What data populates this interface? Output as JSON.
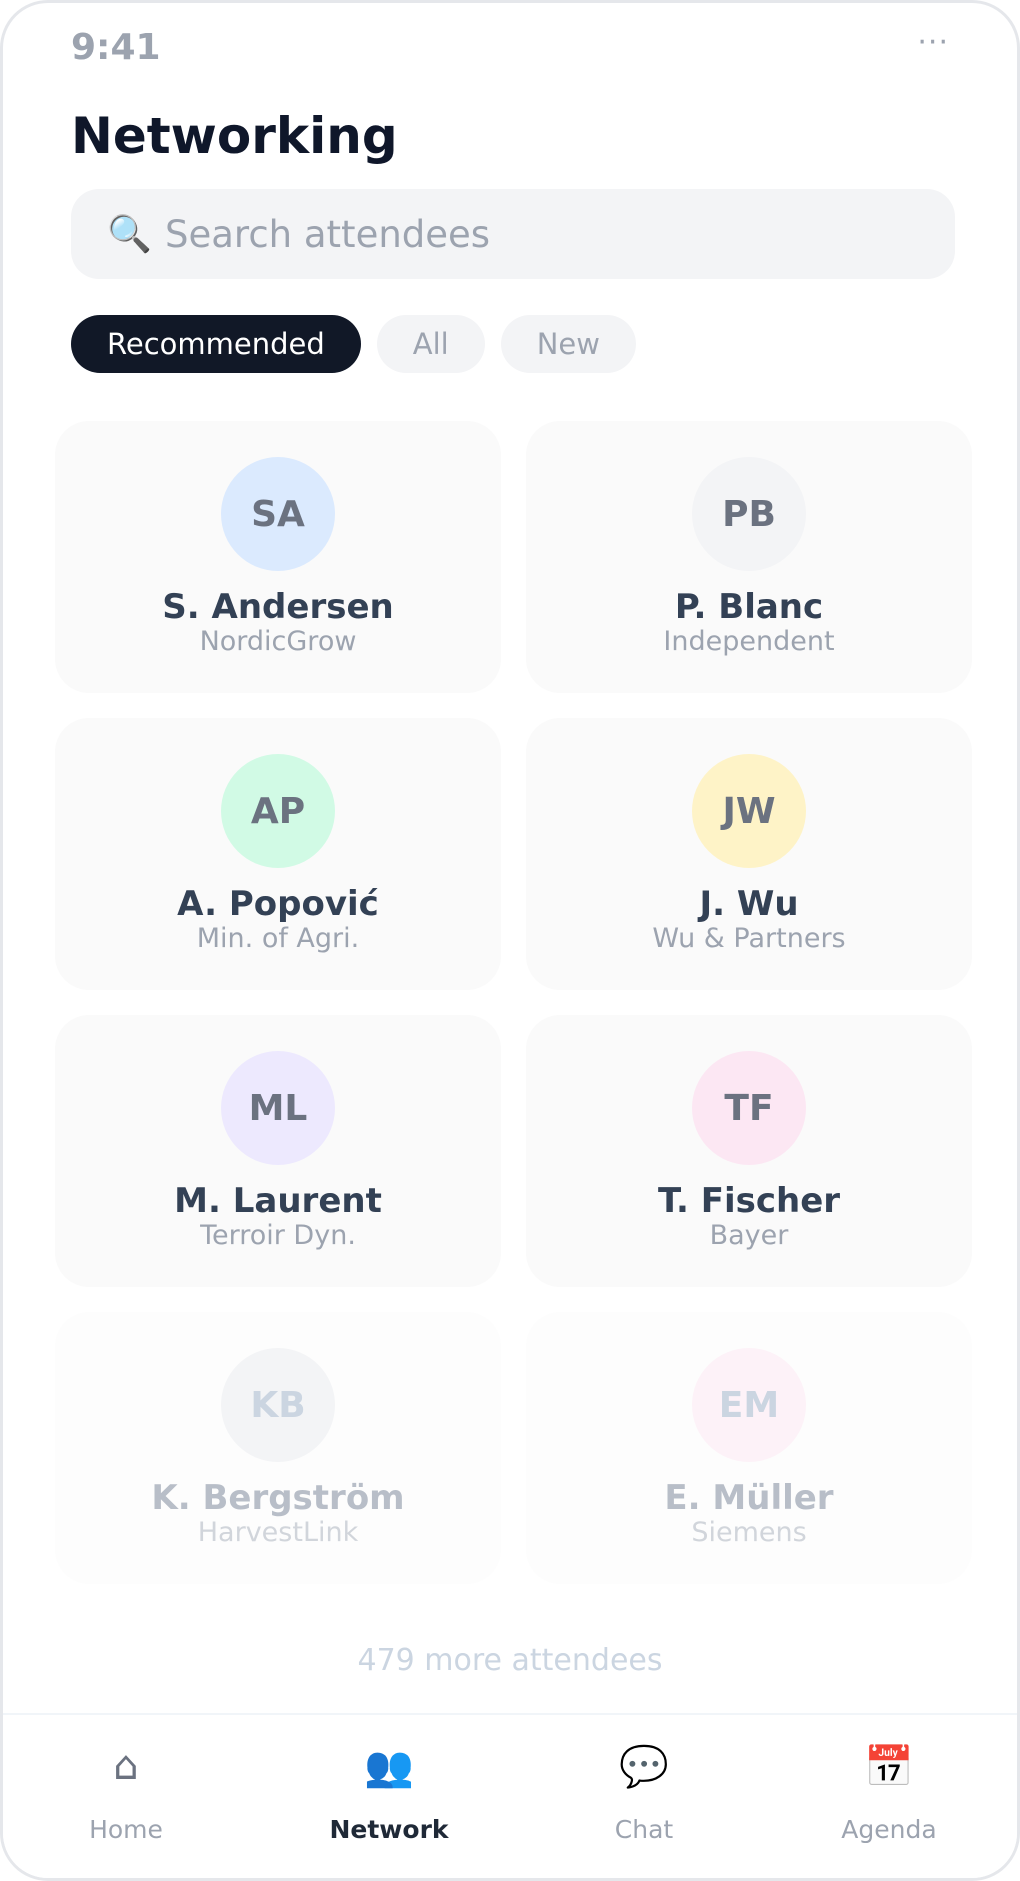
{
  "status_bar": {
    "time": "9:41",
    "more": "···"
  },
  "page": {
    "title": "Networking"
  },
  "search": {
    "icon": "search-icon",
    "placeholder": "Search attendees",
    "value": ""
  },
  "filters": [
    {
      "label": "Recommended",
      "active": true
    },
    {
      "label": "All",
      "active": false
    },
    {
      "label": "New",
      "active": false
    }
  ],
  "attendees": [
    {
      "initials": "SA",
      "name": "S. Andersen",
      "org": "NordicGrow",
      "avatar_color": "#dbeafe"
    },
    {
      "initials": "PB",
      "name": "P. Blanc",
      "org": "Independent",
      "avatar_color": "#f3f4f6"
    },
    {
      "initials": "AP",
      "name": "A. Popović",
      "org": "Min. of Agri.",
      "avatar_color": "#d1fae5"
    },
    {
      "initials": "JW",
      "name": "J. Wu",
      "org": "Wu & Partners",
      "avatar_color": "#fef3c7"
    },
    {
      "initials": "ML",
      "name": "M. Laurent",
      "org": "Terroir Dyn.",
      "avatar_color": "#ede9fe"
    },
    {
      "initials": "TF",
      "name": "T. Fischer",
      "org": "Bayer",
      "avatar_color": "#fce7f3"
    },
    {
      "initials": "KB",
      "name": "K. Bergström",
      "org": "HarvestLink",
      "avatar_color": "#f3f4f6"
    },
    {
      "initials": "EM",
      "name": "E. Müller",
      "org": "Siemens",
      "avatar_color": "#fdf2f8"
    }
  ],
  "more_attendees": "479 more attendees",
  "tab_bar": {
    "tabs": [
      {
        "icon": "home-icon",
        "glyph": "⌂",
        "label": "Home",
        "active": false
      },
      {
        "icon": "people-icon",
        "glyph": "👥",
        "label": "Network",
        "active": true
      },
      {
        "icon": "chat-icon",
        "glyph": "💬",
        "label": "Chat",
        "active": false
      },
      {
        "icon": "calendar-icon",
        "glyph": "📅",
        "label": "Agenda",
        "active": false
      }
    ]
  },
  "colors": {
    "primary": "#111827",
    "accent_blue": "#3b82f6",
    "muted_text": "#9ca3af"
  }
}
